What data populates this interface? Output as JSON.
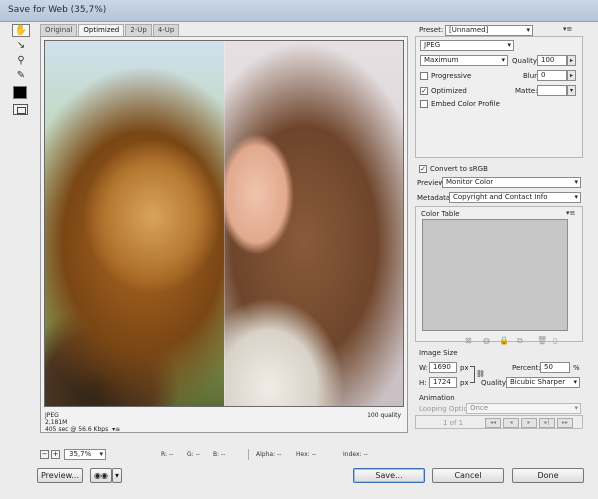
{
  "window": {
    "title": "Save for Web (35,7%)"
  },
  "tabs": [
    "Original",
    "Optimized",
    "2-Up",
    "4-Up"
  ],
  "active_tab": "Optimized",
  "tools": [
    "hand-tool-icon",
    "slice-select-icon",
    "zoom-icon",
    "eyedropper-icon"
  ],
  "colors": {
    "eyedropper_color": "#000000",
    "default_button_border": "#3a6fb4"
  },
  "image_info": {
    "format": "JPEG",
    "size": "2,181M",
    "time": "405 sec @ 56.6 Kbps",
    "quality": "100 quality"
  },
  "statusbar": {
    "zoom_minus": "−",
    "zoom_plus": "+",
    "zoom": "35,7%",
    "r": "R: --",
    "g": "G: --",
    "b": "B: --",
    "alpha": "Alpha: --",
    "hex": "Hex: --",
    "index": "Index: --"
  },
  "settings": {
    "preset_label": "Preset:",
    "preset_value": "[Unnamed]",
    "format": "JPEG",
    "compression": "Maximum",
    "quality_label": "Quality:",
    "quality_value": "100",
    "progressive_label": "Progressive",
    "progressive_checked": false,
    "blur_label": "Blur:",
    "blur_value": "0",
    "optimized_label": "Optimized",
    "optimized_checked": true,
    "matte_label": "Matte:",
    "embed_profile_label": "Embed Color Profile",
    "embed_profile_checked": false
  },
  "color": {
    "convert_srgb_label": "Convert to sRGB",
    "convert_srgb_checked": true,
    "preview_label": "Preview:",
    "preview_value": "Monitor Color",
    "metadata_label": "Metadata:",
    "metadata_value": "Copyright and Contact Info"
  },
  "color_table": {
    "title": "Color Table"
  },
  "image_size": {
    "title": "Image Size",
    "w_label": "W:",
    "w_value": "1690",
    "h_label": "H:",
    "h_value": "1724",
    "px": "px",
    "percent_label": "Percent:",
    "percent_value": "50",
    "percent_unit": "%",
    "quality_label": "Quality:",
    "quality_value": "Bicubic Sharper"
  },
  "animation": {
    "title": "Animation",
    "looping_label": "Looping Options:",
    "looping_value": "Once",
    "frame_counter": "1 of 1"
  },
  "buttons": {
    "preview": "Preview...",
    "save": "Save...",
    "cancel": "Cancel",
    "done": "Done"
  }
}
